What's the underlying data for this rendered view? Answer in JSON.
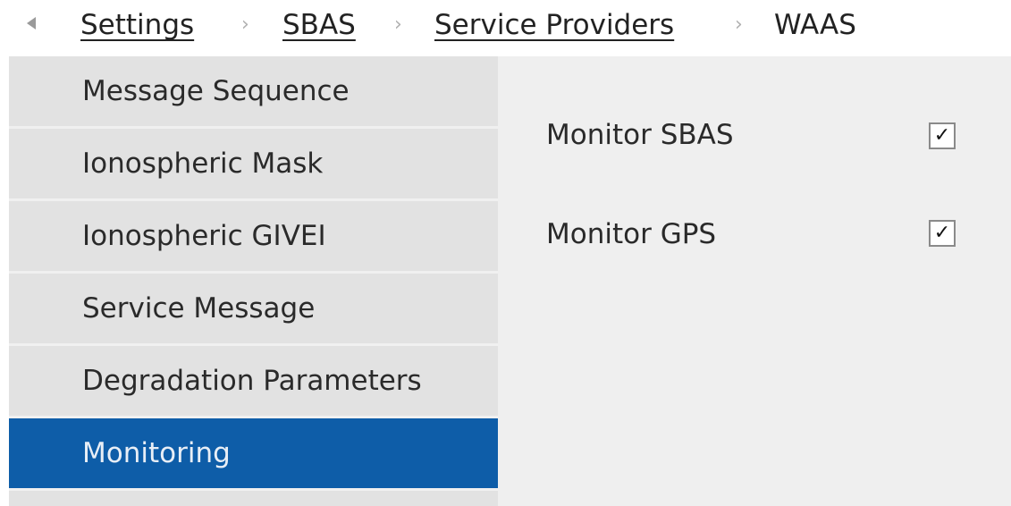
{
  "breadcrumb": {
    "items": [
      "Settings",
      "SBAS",
      "Service Providers",
      "WAAS"
    ],
    "separator": "›"
  },
  "sidebar": {
    "items": [
      {
        "label": "Message Sequence",
        "active": false
      },
      {
        "label": "Ionospheric Mask",
        "active": false
      },
      {
        "label": "Ionospheric GIVEI",
        "active": false
      },
      {
        "label": "Service Message",
        "active": false
      },
      {
        "label": "Degradation Parameters",
        "active": false
      },
      {
        "label": "Monitoring",
        "active": true
      }
    ]
  },
  "content": {
    "options": [
      {
        "label": "Monitor SBAS",
        "checked": true,
        "mark": "✓"
      },
      {
        "label": "Monitor GPS",
        "checked": true,
        "mark": "✓"
      }
    ]
  },
  "colors": {
    "active_item": "#0e5da8",
    "sidebar_item": "#e2e2e2",
    "content_bg": "#efefef"
  }
}
